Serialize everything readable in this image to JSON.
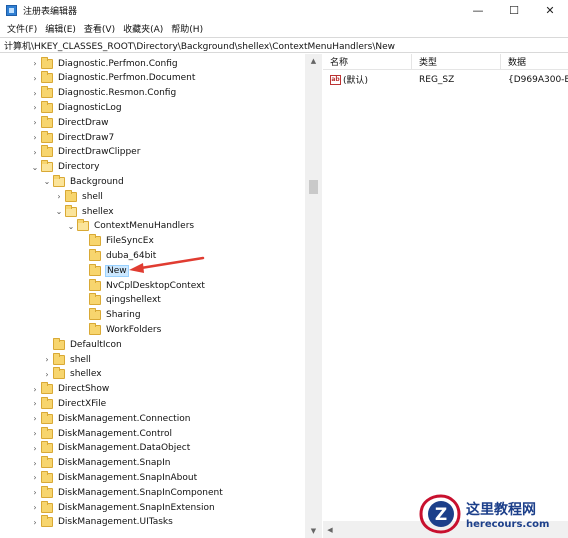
{
  "window": {
    "title": "注册表编辑器",
    "minimize_glyph": "—",
    "maximize_glyph": "☐",
    "close_glyph": "✕"
  },
  "menu": [
    "文件(F)",
    "编辑(E)",
    "查看(V)",
    "收藏夹(A)",
    "帮助(H)"
  ],
  "address": "计算机\\HKEY_CLASSES_ROOT\\Directory\\Background\\shellex\\ContextMenuHandlers\\New",
  "tree": [
    {
      "label": "Diagnostic.Perfmon.Config",
      "level": 0,
      "chevron": "›"
    },
    {
      "label": "Diagnostic.Perfmon.Document",
      "level": 0,
      "chevron": "›"
    },
    {
      "label": "Diagnostic.Resmon.Config",
      "level": 0,
      "chevron": "›"
    },
    {
      "label": "DiagnosticLog",
      "level": 0,
      "chevron": "›"
    },
    {
      "label": "DirectDraw",
      "level": 0,
      "chevron": "›"
    },
    {
      "label": "DirectDraw7",
      "level": 0,
      "chevron": "›"
    },
    {
      "label": "DirectDrawClipper",
      "level": 0,
      "chevron": "›"
    },
    {
      "label": "Directory",
      "level": 0,
      "chevron": "⌄",
      "open": true
    },
    {
      "label": "Background",
      "level": 1,
      "chevron": "⌄",
      "open": true
    },
    {
      "label": "shell",
      "level": 2,
      "chevron": "›"
    },
    {
      "label": "shellex",
      "level": 2,
      "chevron": "⌄",
      "open": true
    },
    {
      "label": "ContextMenuHandlers",
      "level": 3,
      "chevron": "⌄",
      "open": true
    },
    {
      "label": "FileSyncEx",
      "level": 4,
      "chevron": ""
    },
    {
      "label": "duba_64bit",
      "level": 4,
      "chevron": ""
    },
    {
      "label": "New",
      "level": 4,
      "chevron": "",
      "selected": true
    },
    {
      "label": "NvCplDesktopContext",
      "level": 4,
      "chevron": ""
    },
    {
      "label": "qingshellext",
      "level": 4,
      "chevron": ""
    },
    {
      "label": "Sharing",
      "level": 4,
      "chevron": ""
    },
    {
      "label": "WorkFolders",
      "level": 4,
      "chevron": ""
    },
    {
      "label": "DefaultIcon",
      "level": 1,
      "chevron": ""
    },
    {
      "label": "shell",
      "level": 1,
      "chevron": "›"
    },
    {
      "label": "shellex",
      "level": 1,
      "chevron": "›"
    },
    {
      "label": "DirectShow",
      "level": 0,
      "chevron": "›"
    },
    {
      "label": "DirectXFile",
      "level": 0,
      "chevron": "›"
    },
    {
      "label": "DiskManagement.Connection",
      "level": 0,
      "chevron": "›"
    },
    {
      "label": "DiskManagement.Control",
      "level": 0,
      "chevron": "›"
    },
    {
      "label": "DiskManagement.DataObject",
      "level": 0,
      "chevron": "›"
    },
    {
      "label": "DiskManagement.SnapIn",
      "level": 0,
      "chevron": "›"
    },
    {
      "label": "DiskManagement.SnapInAbout",
      "level": 0,
      "chevron": "›"
    },
    {
      "label": "DiskManagement.SnapInComponent",
      "level": 0,
      "chevron": "›"
    },
    {
      "label": "DiskManagement.SnapInExtension",
      "level": 0,
      "chevron": "›"
    },
    {
      "label": "DiskManagement.UITasks",
      "level": 0,
      "chevron": "›"
    }
  ],
  "list": {
    "headers": {
      "name": "名称",
      "type": "类型",
      "data": "数据"
    },
    "rows": [
      {
        "icon": "string-value-icon",
        "icon_glyph": "ab",
        "name": "(默认)",
        "type": "REG_SZ",
        "data": "{D969A300-E"
      }
    ]
  },
  "scroll_glyphs": {
    "up": "▲",
    "down": "▼",
    "left": "◀",
    "right": "▶"
  },
  "watermark": {
    "title": "这里教程网",
    "url": "herecours.com",
    "logo_letter": "Z"
  },
  "colors": {
    "selection_bg": "#cce8ff",
    "folder": "#f7d56e",
    "arrow": "#e03c31",
    "watermark_blue": "#1c3f8a"
  }
}
